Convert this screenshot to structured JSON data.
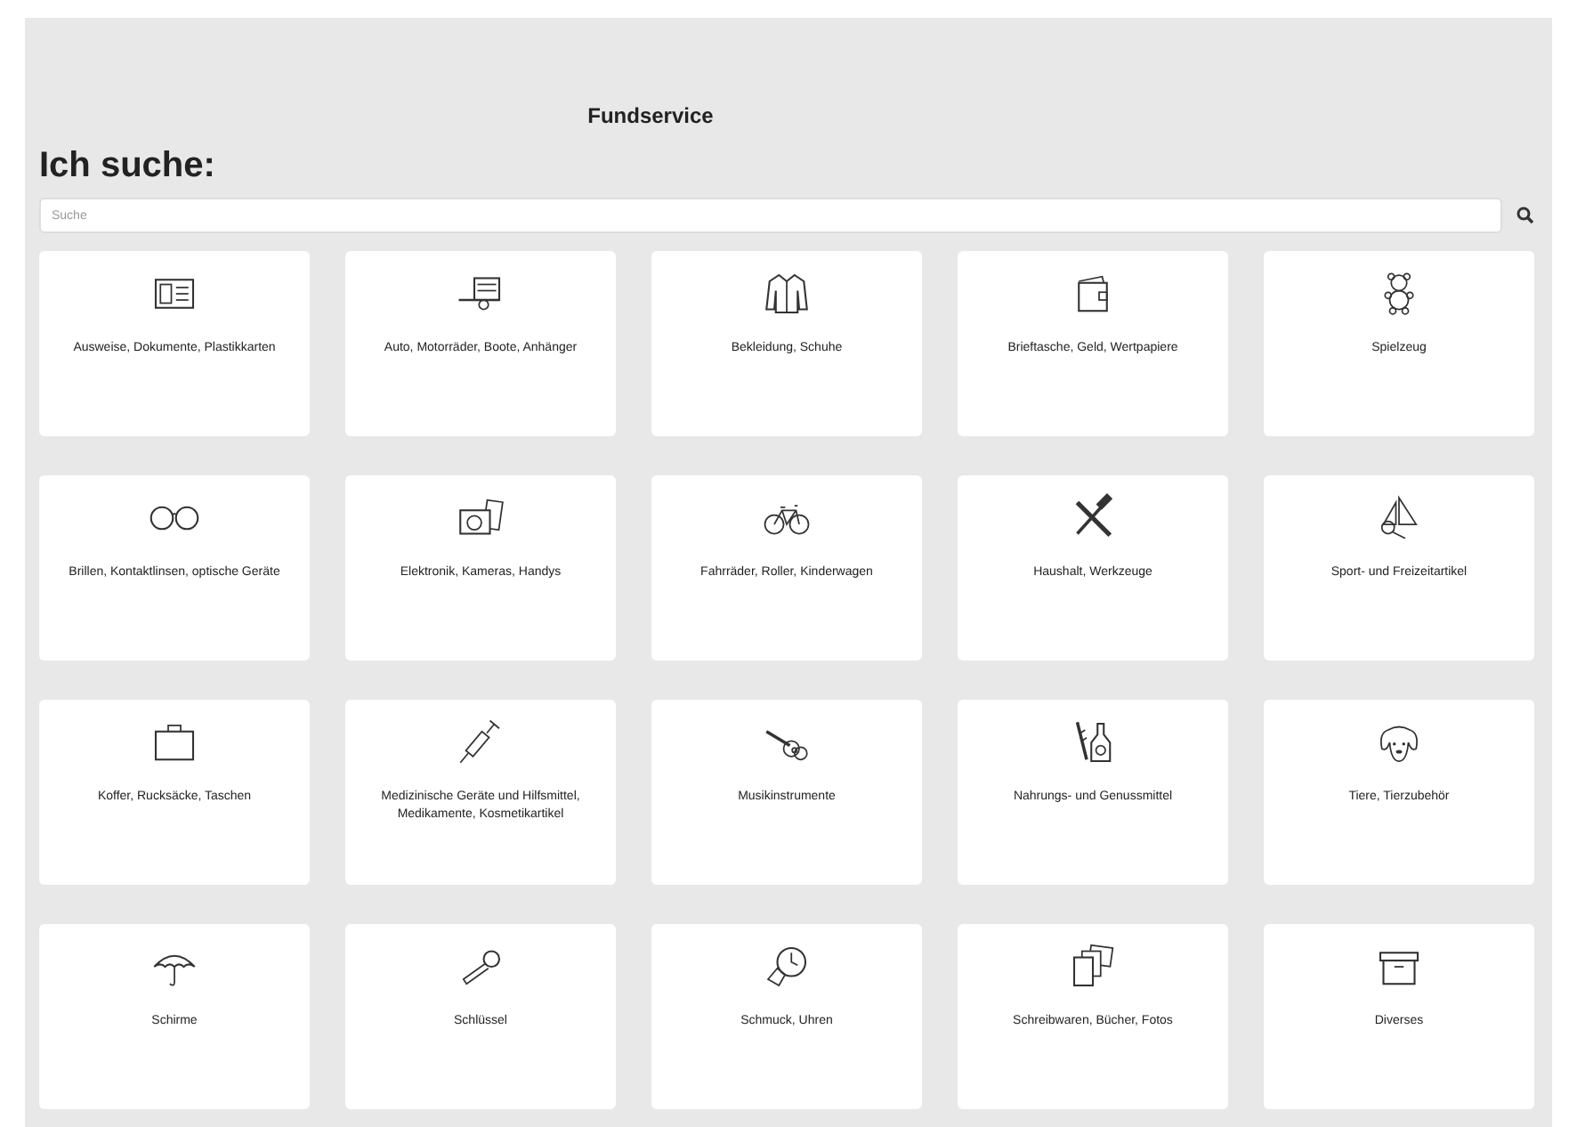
{
  "header": {
    "title": "Fundservice"
  },
  "search": {
    "heading": "Ich suche:",
    "placeholder": "Suche"
  },
  "categories": [
    {
      "label": "Ausweise, Dokumente, Plastikkarten"
    },
    {
      "label": "Auto, Motorräder, Boote, Anhänger"
    },
    {
      "label": "Bekleidung, Schuhe"
    },
    {
      "label": "Brieftasche, Geld, Wertpapiere"
    },
    {
      "label": "Spielzeug"
    },
    {
      "label": "Brillen, Kontaktlinsen, optische Geräte"
    },
    {
      "label": "Elektronik, Kameras, Handys"
    },
    {
      "label": "Fahrräder, Roller, Kinderwagen"
    },
    {
      "label": "Haushalt, Werkzeuge"
    },
    {
      "label": "Sport- und Freizeitartikel"
    },
    {
      "label": "Koffer, Rucksäcke, Taschen"
    },
    {
      "label": "Medizinische Geräte und Hilfsmittel, Medikamente, Kosmetikartikel"
    },
    {
      "label": "Musikinstrumente"
    },
    {
      "label": "Nahrungs- und Genussmittel"
    },
    {
      "label": "Tiere, Tierzubehör"
    },
    {
      "label": "Schirme"
    },
    {
      "label": "Schlüssel"
    },
    {
      "label": "Schmuck, Uhren"
    },
    {
      "label": "Schreibwaren, Bücher, Fotos"
    },
    {
      "label": "Diverses"
    }
  ]
}
